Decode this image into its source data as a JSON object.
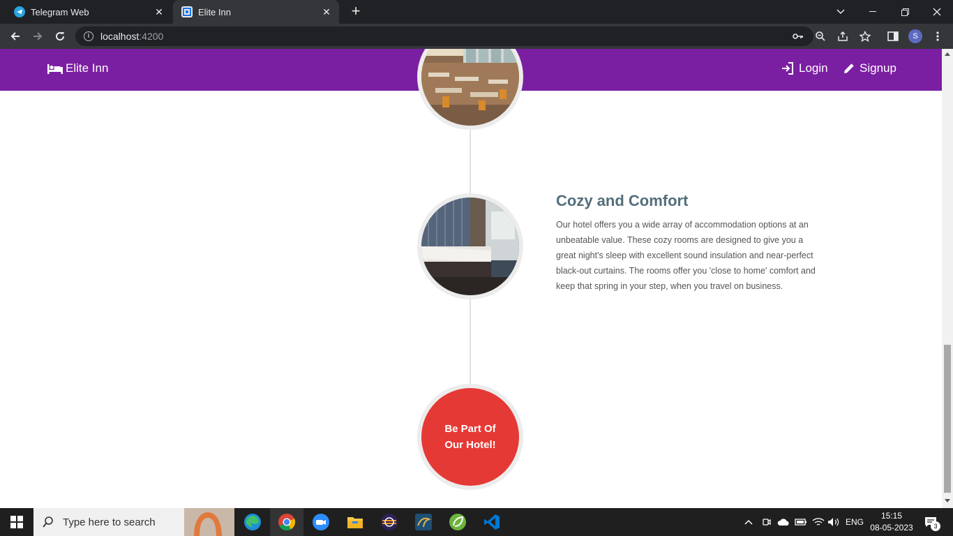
{
  "browser": {
    "tabs": [
      {
        "title": "Telegram Web",
        "active": false
      },
      {
        "title": "Elite Inn",
        "active": true
      }
    ],
    "url_host": "localhost",
    "url_port": ":4200",
    "profile_initial": "S"
  },
  "navbar": {
    "brand": "Elite Inn",
    "links": [
      {
        "label": "Login",
        "icon": "login-icon"
      },
      {
        "label": "Signup",
        "icon": "pencil-icon"
      }
    ]
  },
  "timeline": {
    "entry": {
      "title": "Cozy and Comfort",
      "text": "Our hotel offers you a wide array of accommodation options at an unbeatable value. These cozy rooms are designed to give you a great night's sleep with excellent sound insulation and near-perfect black-out curtains. The rooms offer you 'close to home' comfort and keep that spring in your step, when you travel on business."
    },
    "cta": "Be Part Of Our Hotel!"
  },
  "colors": {
    "navbar": "#7b1fa2",
    "cta": "#e53935",
    "heading": "#546e7a"
  },
  "taskbar": {
    "search_placeholder": "Type here to search",
    "language": "ENG",
    "time": "15:15",
    "date": "08-05-2023",
    "notifications": "3"
  }
}
